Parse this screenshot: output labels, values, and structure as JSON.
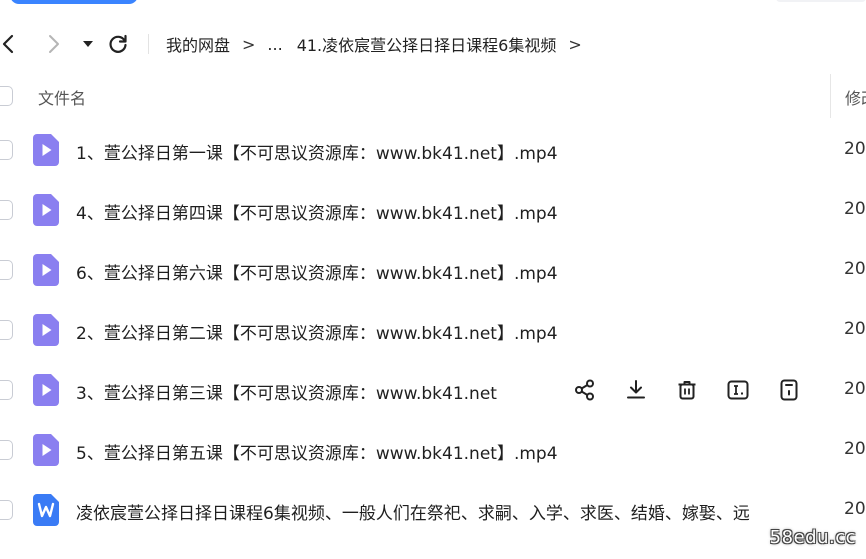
{
  "nav": {
    "back_icon": "chevron-left-icon",
    "forward_icon": "chevron-right-icon",
    "dropdown_icon": "caret-down-icon",
    "refresh_icon": "refresh-icon"
  },
  "breadcrumb": {
    "root": "我的网盘",
    "separator": ">",
    "ellipsis": "...",
    "current": "41.凌依宸萱公择日择日课程6集视频",
    "trailing_separator": ">"
  },
  "columns": {
    "name": "文件名",
    "modified": "修改"
  },
  "files": [
    {
      "name": "1、萱公择日第一课【不可思议资源库：www.bk41.net】.mp4",
      "type": "video",
      "date": "20"
    },
    {
      "name": "4、萱公择日第四课【不可思议资源库：www.bk41.net】.mp4",
      "type": "video",
      "date": "20"
    },
    {
      "name": "6、萱公择日第六课【不可思议资源库：www.bk41.net】.mp4",
      "type": "video",
      "date": "20"
    },
    {
      "name": "2、萱公择日第二课【不可思议资源库：www.bk41.net】.mp4",
      "type": "video",
      "date": "20"
    },
    {
      "name": "3、萱公择日第三课【不可思议资源库：www.bk41.net",
      "type": "video",
      "date": "20"
    },
    {
      "name": "5、萱公择日第五课【不可思议资源库：www.bk41.net】.mp4",
      "type": "video",
      "date": "20"
    },
    {
      "name": "凌依宸萱公择日择日课程6集视频、一般人们在祭祀、求嗣、入学、求医、结婚、嫁娶、远",
      "type": "word",
      "date": "20"
    }
  ],
  "row_actions": [
    "share-icon",
    "download-icon",
    "delete-icon",
    "rename-icon",
    "more-icon"
  ],
  "hovered_row_index": 4,
  "colors": {
    "accent": "#3a84ff",
    "video_icon": "#8a7ff0",
    "word_icon": "#3a7bf5"
  },
  "watermark": "58edu.cc"
}
